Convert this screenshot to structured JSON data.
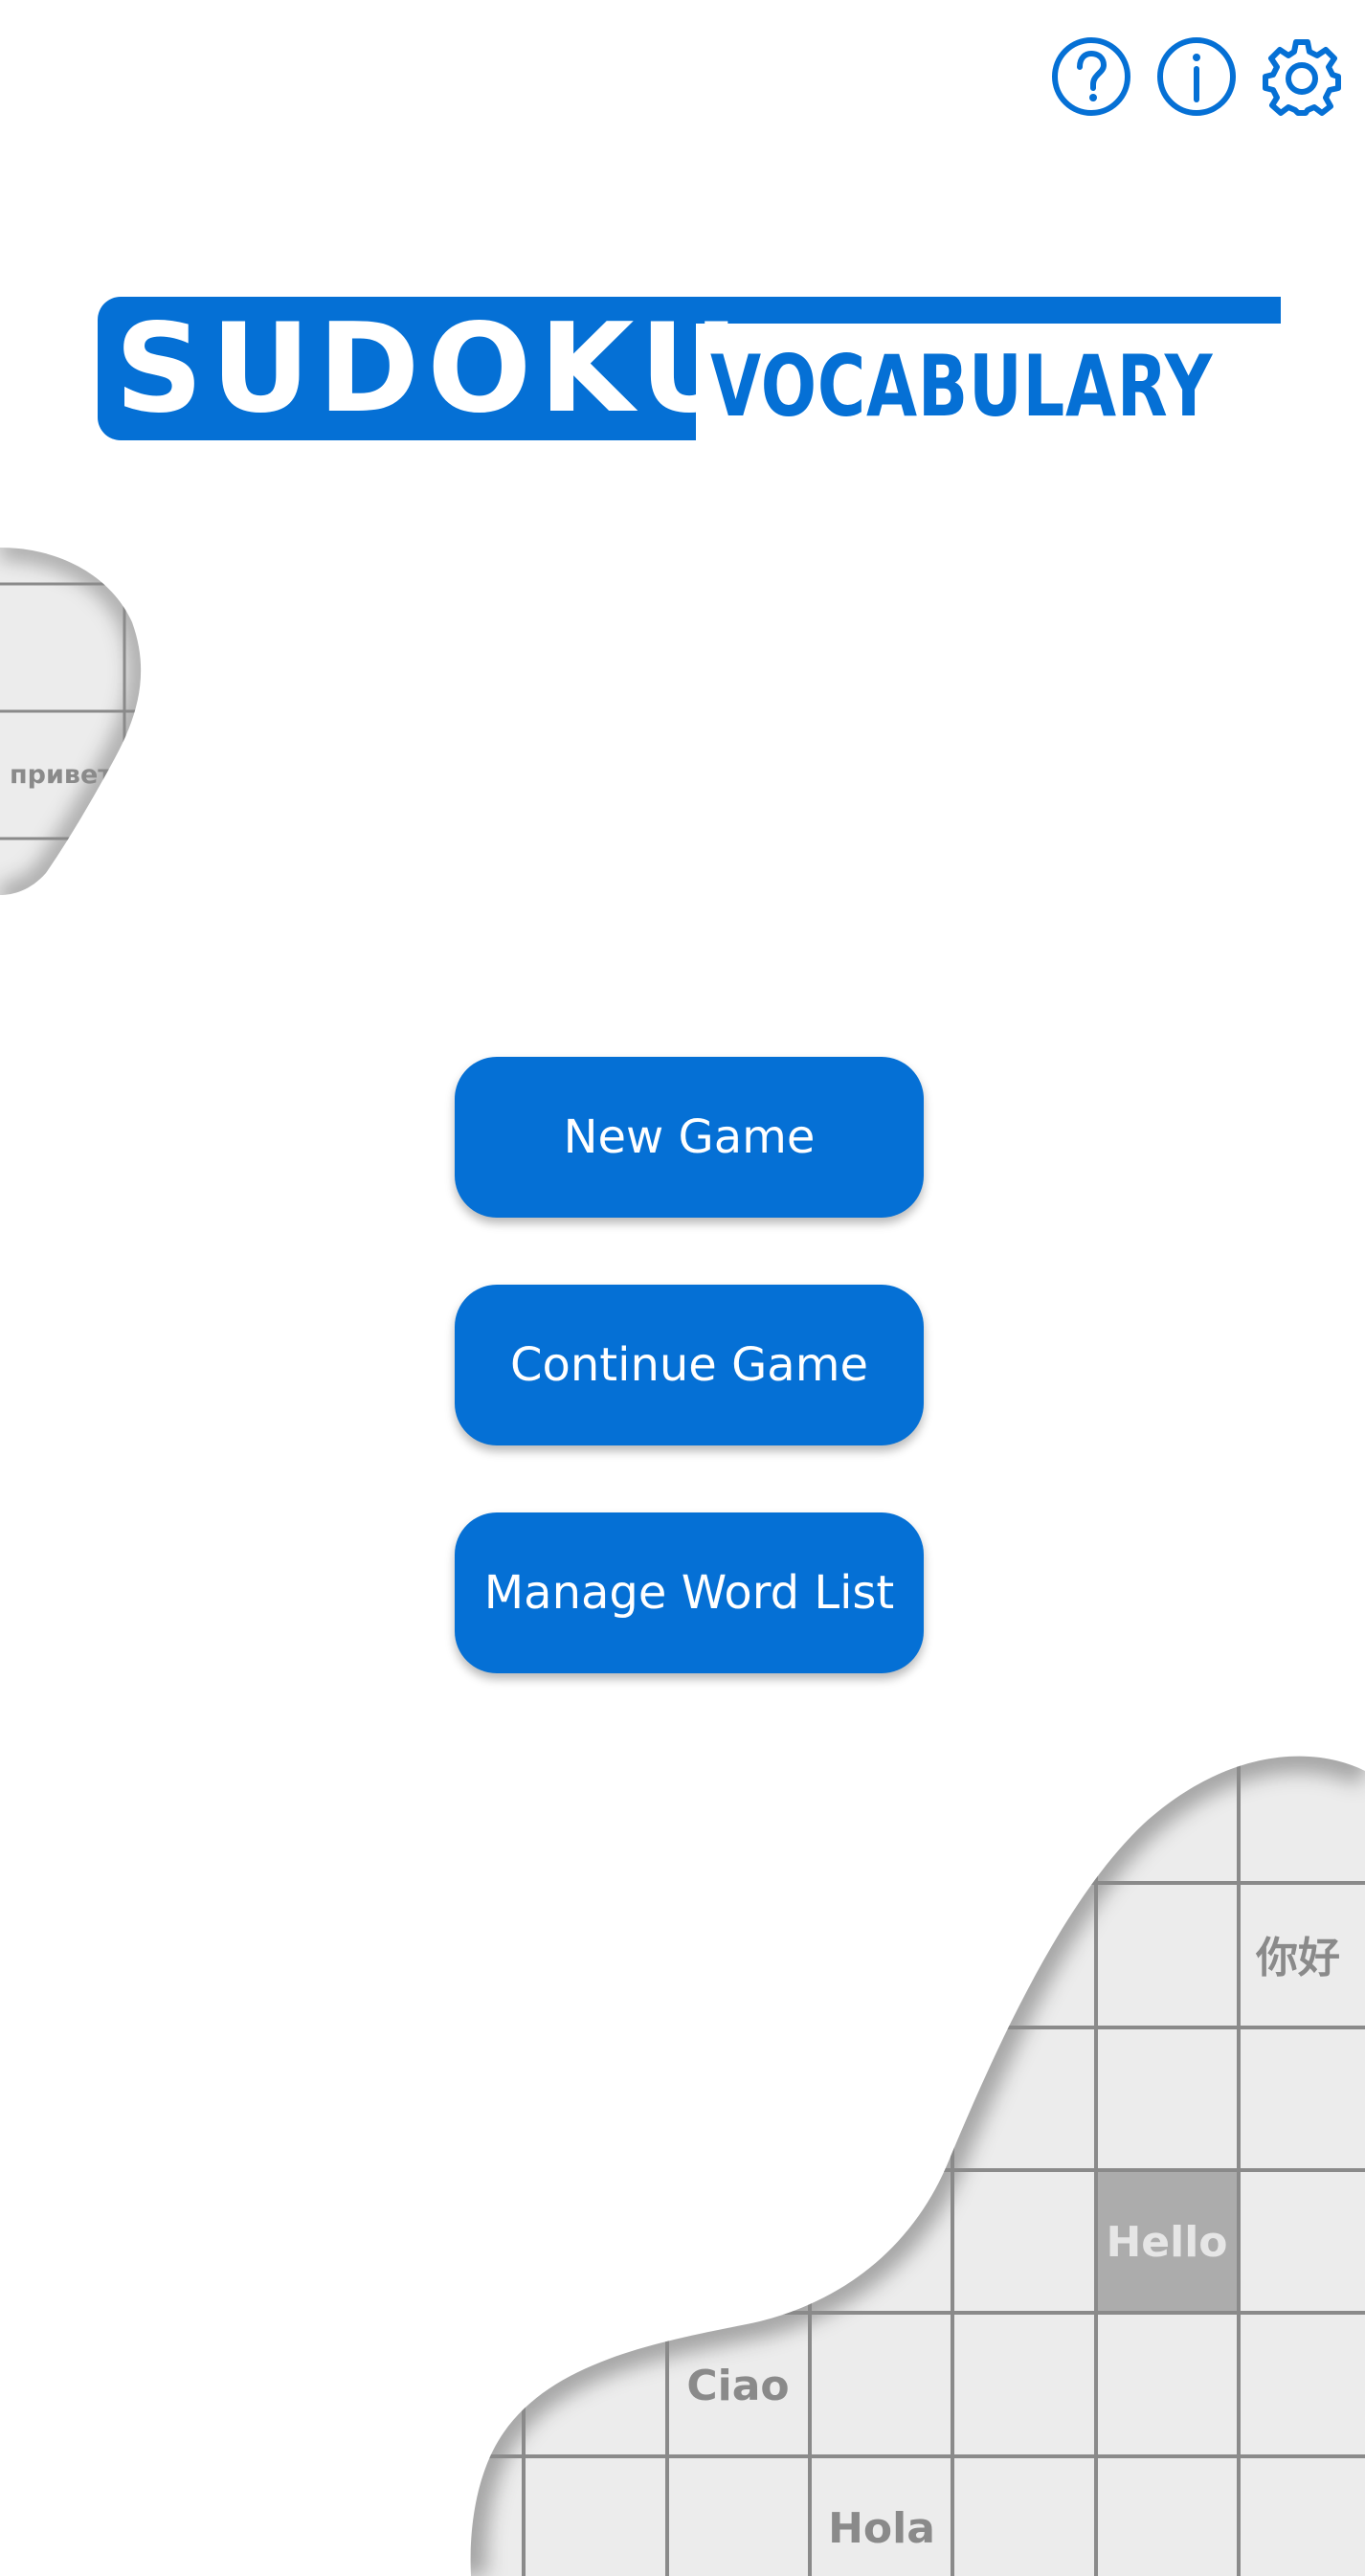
{
  "header": {
    "icons": [
      {
        "name": "help-icon"
      },
      {
        "name": "info-icon"
      },
      {
        "name": "settings-gear-icon"
      }
    ]
  },
  "logo": {
    "word1": "SUDOKU",
    "word2": "VOCABULARY",
    "color": "#0570d5"
  },
  "menu": {
    "new_game": "New Game",
    "continue_game": "Continue Game",
    "manage_word_list": "Manage Word List"
  },
  "background": {
    "grid_words": {
      "russian": "привет",
      "chinese": "你好",
      "english": "Hello",
      "italian": "Ciao",
      "spanish": "Hola"
    }
  },
  "colors": {
    "accent": "#0570d5",
    "background": "#ffffff",
    "grid_fill": "#ececec",
    "grid_line": "#8a8a8a",
    "grid_text": "#8a8a8a",
    "highlight_cell": "#acacac"
  }
}
